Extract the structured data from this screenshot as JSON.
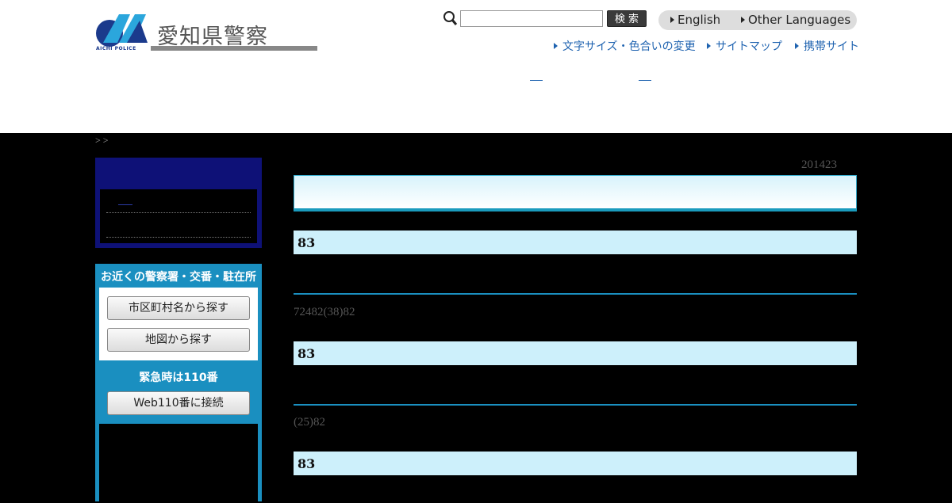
{
  "header": {
    "logo_text": "愛知県警察",
    "logo_sub": "AICHI  POLICE",
    "search": {
      "placeholder": "",
      "button_label": "検 索"
    },
    "languages": [
      "English",
      "Other Languages"
    ],
    "utility_links": [
      "文字サイズ・色合いの変更",
      "サイトマップ",
      "携帯サイト"
    ]
  },
  "breadcrumb": " > > ",
  "left_nav": {
    "station_title": "お近くの警察署・交番・駐在所",
    "buttons": [
      "市区町村名から探す",
      "地図から探す"
    ],
    "emergency_label": "緊急時は110番",
    "web110_label": "Web110番に接続"
  },
  "main": {
    "date": "201423",
    "sections": [
      {
        "heading": "83",
        "text": "72482(38)82"
      },
      {
        "heading": "83",
        "text": "(25)82"
      },
      {
        "heading": "83",
        "text": ""
      }
    ]
  },
  "colors": {
    "accent": "#1a8fc0",
    "nav_bg": "#0e1177",
    "heading_bg": "#cdf0fb",
    "link": "#1f63b0"
  }
}
